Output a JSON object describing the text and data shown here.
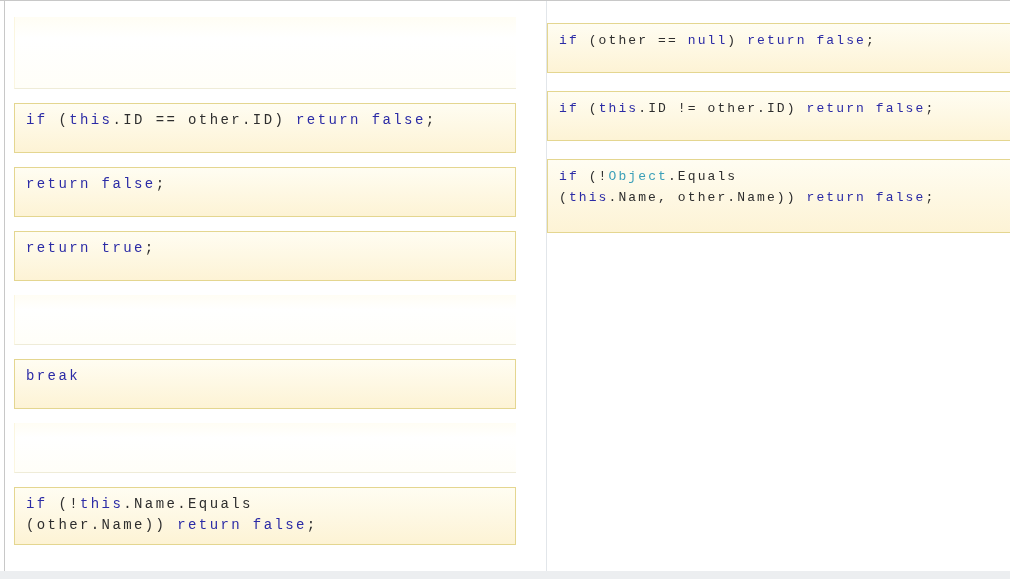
{
  "answer_slots": [
    {
      "filled": false
    },
    {
      "filled": true,
      "lines": [
        [
          {
            "t": "if",
            "color": "#2b2ba6"
          },
          {
            "t": " ("
          },
          {
            "t": "this",
            "color": "#2b2ba6"
          },
          {
            "t": ".ID == other.ID) "
          },
          {
            "t": "return false",
            "color": "#2b2ba6"
          },
          {
            "t": ";"
          }
        ]
      ]
    },
    {
      "filled": true,
      "lines": [
        [
          {
            "t": "return false",
            "color": "#2b2ba6"
          },
          {
            "t": ";"
          }
        ]
      ]
    },
    {
      "filled": true,
      "lines": [
        [
          {
            "t": "return true",
            "color": "#2b2ba6"
          },
          {
            "t": ";"
          }
        ]
      ]
    },
    {
      "filled": false
    },
    {
      "filled": true,
      "lines": [
        [
          {
            "t": "break",
            "color": "#2b2ba6"
          }
        ]
      ]
    },
    {
      "filled": false
    },
    {
      "filled": true,
      "lines": [
        [
          {
            "t": "if",
            "color": "#2b2ba6"
          },
          {
            "t": " (!"
          },
          {
            "t": "this",
            "color": "#2b2ba6"
          },
          {
            "t": ".Name.Equals"
          }
        ],
        [
          {
            "t": "(other.Name)) "
          },
          {
            "t": "return false",
            "color": "#2b2ba6"
          },
          {
            "t": ";"
          }
        ]
      ]
    }
  ],
  "choices": [
    {
      "lines": [
        [
          {
            "t": "if",
            "color": "#2b2ba6"
          },
          {
            "t": " (other == "
          },
          {
            "t": "null",
            "color": "#2b2ba6"
          },
          {
            "t": ") "
          },
          {
            "t": "return false",
            "color": "#2b2ba6"
          },
          {
            "t": ";"
          }
        ]
      ]
    },
    {
      "lines": [
        [
          {
            "t": "if",
            "color": "#2b2ba6"
          },
          {
            "t": " ("
          },
          {
            "t": "this",
            "color": "#2b2ba6"
          },
          {
            "t": ".ID != other.ID) "
          },
          {
            "t": "return false",
            "color": "#2b2ba6"
          },
          {
            "t": ";"
          }
        ]
      ]
    },
    {
      "lines": [
        [
          {
            "t": "if",
            "color": "#2b2ba6"
          },
          {
            "t": " (!"
          },
          {
            "t": "Object",
            "color": "#3a9fb8"
          },
          {
            "t": ".Equals"
          }
        ],
        [
          {
            "t": "("
          },
          {
            "t": "this",
            "color": "#2b2ba6"
          },
          {
            "t": ".Name, other.Name)) "
          },
          {
            "t": "return false",
            "color": "#2b2ba6"
          },
          {
            "t": ";"
          }
        ]
      ]
    }
  ]
}
